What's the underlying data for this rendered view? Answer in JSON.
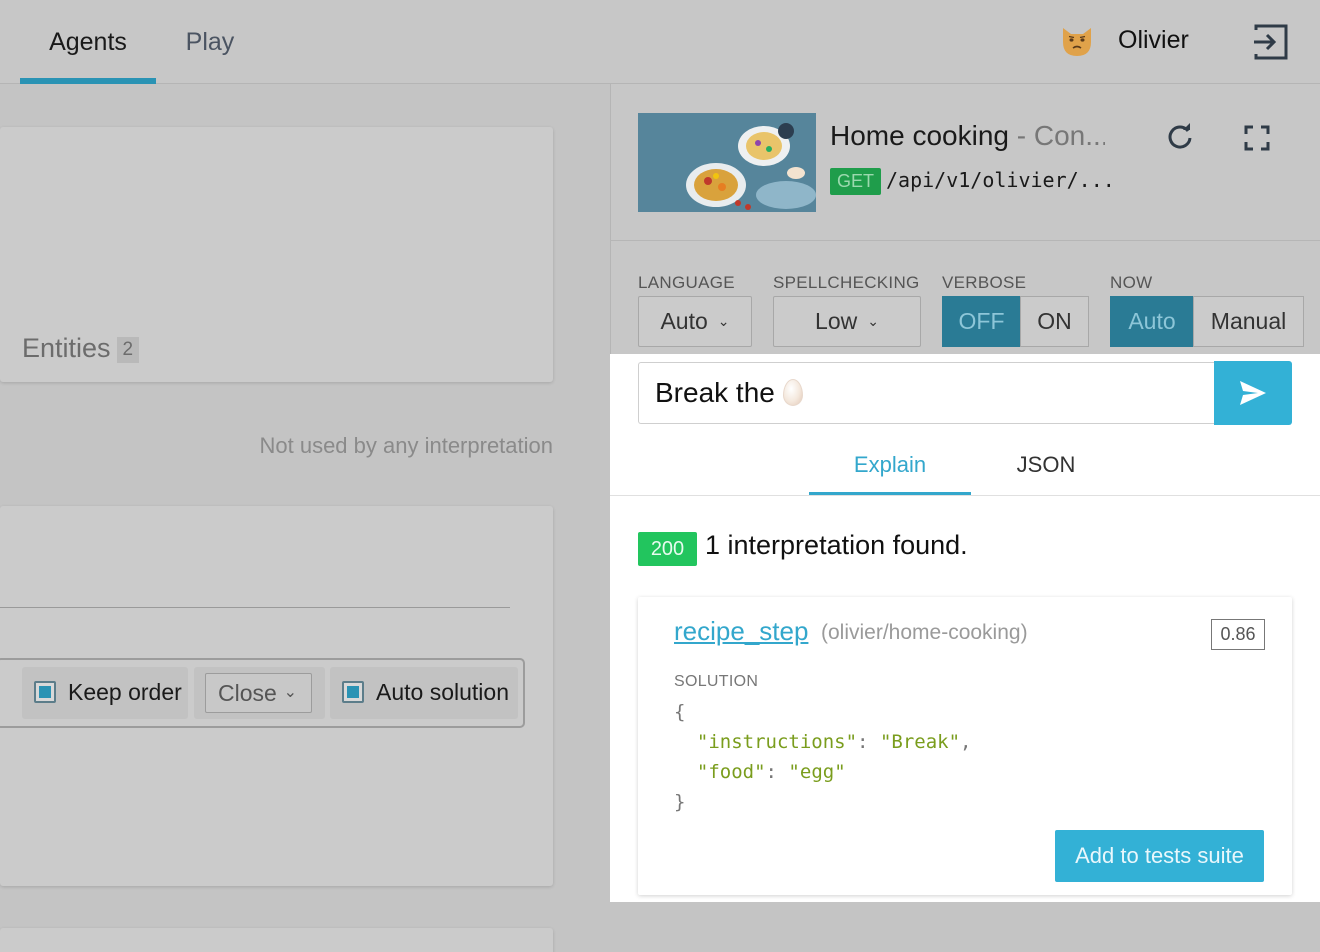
{
  "nav": {
    "tabs": [
      {
        "label": "Agents",
        "active": true
      },
      {
        "label": "Play",
        "active": false
      }
    ],
    "user": {
      "name": "Olivier",
      "avatar_icon": "cat-emoji-icon"
    },
    "logout_icon": "logout-icon"
  },
  "left": {
    "entities_label": "Entities",
    "entities_count": "2",
    "not_used_text": "Not used by any interpretation",
    "options": {
      "keep_order_label": "Keep order",
      "close_select_value": "Close",
      "auto_solution_label": "Auto solution"
    }
  },
  "agent": {
    "title": "Home cooking",
    "subtitle": " - Con...",
    "method": "GET",
    "endpoint": "/api/v1/olivier/..."
  },
  "controls": {
    "language": {
      "label": "LANGUAGE",
      "value": "Auto"
    },
    "spellchecking": {
      "label": "SPELLCHECKING",
      "value": "Low"
    },
    "verbose": {
      "label": "VERBOSE",
      "off": "OFF",
      "on": "ON",
      "selected": "OFF"
    },
    "now": {
      "label": "NOW",
      "auto": "Auto",
      "manual": "Manual",
      "selected": "Auto"
    }
  },
  "console": {
    "query": "Break the",
    "query_emoji": "egg-emoji",
    "tabs": {
      "explain": "Explain",
      "json": "JSON"
    },
    "status_code": "200",
    "status_text": "1 interpretation found.",
    "interpretation": {
      "intent": "recipe_step",
      "namespace": "(olivier/home-cooking)",
      "score": "0.86",
      "solution_label": "SOLUTION",
      "solution": {
        "instructions": "Break",
        "food": "egg"
      }
    },
    "add_button": "Add to tests suite"
  },
  "colors": {
    "accent": "#33b1d6",
    "status_ok": "#22c55e",
    "get_method": "#1f9d4b"
  }
}
